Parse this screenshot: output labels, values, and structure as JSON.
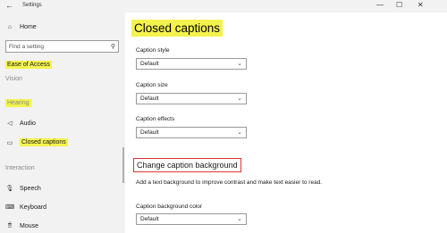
{
  "window": {
    "title": "Settings",
    "back_icon": "←",
    "minimize_icon": "—",
    "maximize_icon": "☐",
    "close_icon": "✕"
  },
  "sidebar": {
    "home": {
      "icon": "⌂",
      "label": "Home"
    },
    "search": {
      "placeholder": "Find a setting",
      "icon": "⚲"
    },
    "category": "Ease of Access",
    "section_vision": "Vision",
    "section_hearing": "Hearing",
    "audio": {
      "icon": "◁",
      "label": "Audio"
    },
    "closed_captions": {
      "icon": "▭",
      "label": "Closed captions"
    },
    "section_interaction": "Interaction",
    "speech": {
      "icon": "🎙",
      "label": "Speech"
    },
    "keyboard": {
      "icon": "⌨",
      "label": "Keyboard"
    },
    "mouse": {
      "icon": "🖱",
      "label": "Mouse"
    }
  },
  "main": {
    "title": "Closed captions",
    "caption_style": {
      "label": "Caption style",
      "value": "Default"
    },
    "caption_size": {
      "label": "Caption size",
      "value": "Default"
    },
    "caption_effects": {
      "label": "Caption effects",
      "value": "Default"
    },
    "background_heading": "Change caption background",
    "background_desc": "Add a text background to improve contrast and make text easier to read.",
    "caption_background_color": {
      "label": "Caption background color",
      "value": "Default"
    },
    "chevron_icon": "⌄"
  },
  "colors": {
    "highlight": "#f4f34d",
    "box_border": "#e03535",
    "sidebar_bg": "#f2f2f2"
  }
}
